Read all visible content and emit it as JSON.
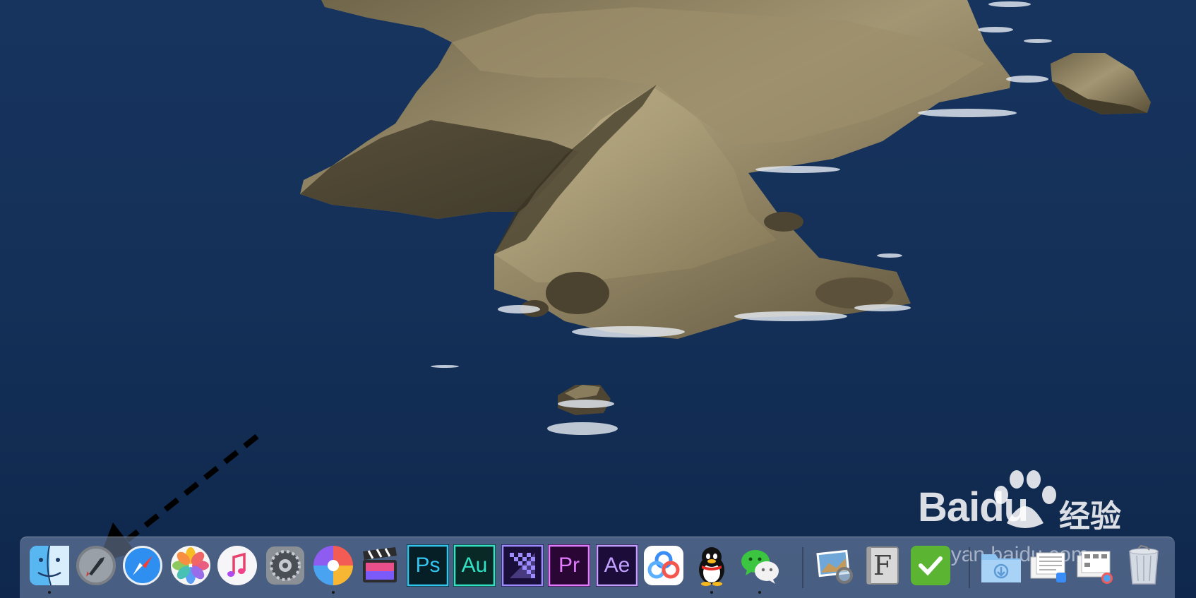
{
  "colors": {
    "sea": "#173465",
    "rock": "#8a7d5e",
    "dock": "#7d8fb0",
    "dot": "#1a1a1a"
  },
  "dock": {
    "apps": [
      {
        "name": "Finder",
        "icon": "finder-icon",
        "running": true
      },
      {
        "name": "Launchpad",
        "icon": "launchpad-rocket-icon",
        "running": false
      },
      {
        "name": "Safari",
        "icon": "safari-compass-icon",
        "running": false
      },
      {
        "name": "Photos",
        "icon": "photos-flower-icon",
        "running": false
      },
      {
        "name": "Music",
        "icon": "music-note-icon",
        "running": false
      },
      {
        "name": "System Preferences",
        "icon": "gear-icon",
        "running": false
      },
      {
        "name": "Pinwheel",
        "icon": "pinwheel-icon",
        "running": true
      },
      {
        "name": "Final Cut Pro",
        "icon": "clapperboard-icon",
        "running": false
      },
      {
        "name": "Photoshop",
        "icon": "photoshop-icon",
        "label": "Ps",
        "running": false
      },
      {
        "name": "Audition",
        "icon": "audition-icon",
        "label": "Au",
        "running": false
      },
      {
        "name": "Media Encoder",
        "icon": "media-encoder-icon",
        "running": false
      },
      {
        "name": "Premiere Pro",
        "icon": "premiere-icon",
        "label": "Pr",
        "running": false
      },
      {
        "name": "After Effects",
        "icon": "after-effects-icon",
        "label": "Ae",
        "running": false
      },
      {
        "name": "Baidu Netdisk",
        "icon": "cloud-share-icon",
        "running": false
      },
      {
        "name": "QQ",
        "icon": "penguin-icon",
        "running": true
      },
      {
        "name": "WeChat",
        "icon": "chat-bubbles-icon",
        "running": true
      }
    ],
    "others": [
      {
        "name": "Preview",
        "icon": "preview-photos-icon"
      },
      {
        "name": "Font Book",
        "icon": "font-book-icon",
        "label": "F"
      },
      {
        "name": "Tasks",
        "icon": "checkmark-icon"
      },
      {
        "name": "Downloads",
        "icon": "downloads-folder-icon"
      },
      {
        "name": "Documents",
        "icon": "documents-stack-icon"
      },
      {
        "name": "Applications",
        "icon": "applications-stack-icon"
      },
      {
        "name": "Trash",
        "icon": "trash-icon"
      }
    ]
  },
  "watermark": {
    "brand_latin": "Baidu",
    "brand_cjk": "经验",
    "url": "jingyan.baidu.com"
  }
}
